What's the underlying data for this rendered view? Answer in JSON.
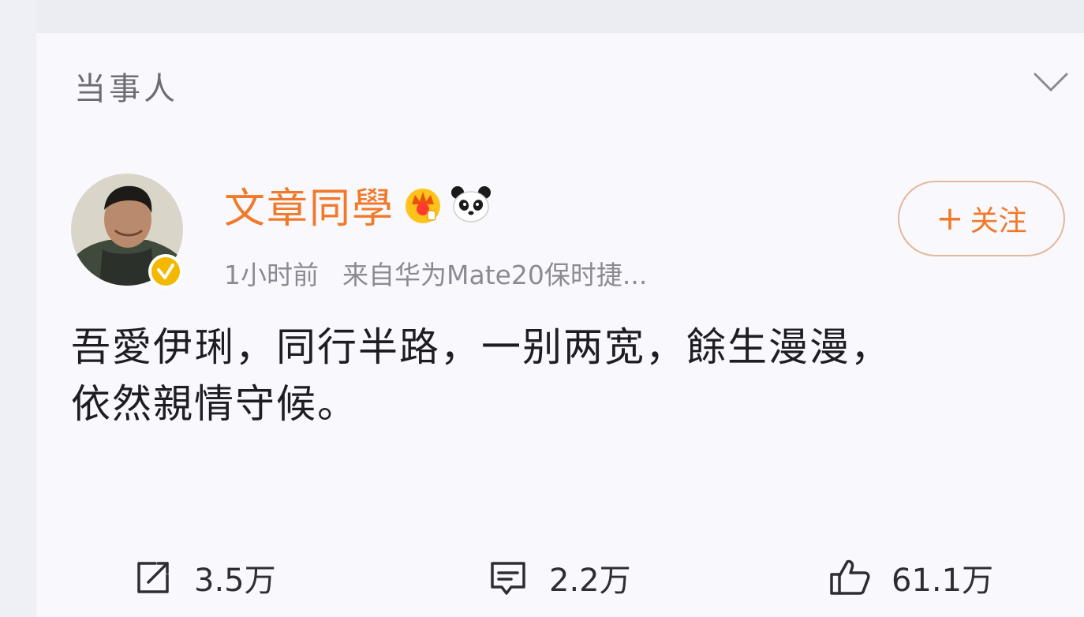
{
  "section": {
    "label": "当事人"
  },
  "user": {
    "name": "文章同學",
    "badges": [
      "crown-icon",
      "panda-icon"
    ],
    "verified": true
  },
  "post": {
    "time": "1小时前",
    "source": "来自华为Mate20保时捷...",
    "lines": [
      "吾愛伊琍，同行半路，一别两宽，餘生漫漫，",
      "依然親情守候。"
    ]
  },
  "follow_button": {
    "plus": "+",
    "label": "关注"
  },
  "actions": {
    "repost": {
      "icon": "repost-icon",
      "count": "3.5万"
    },
    "comment": {
      "icon": "comment-icon",
      "count": "2.2万"
    },
    "like": {
      "icon": "thumbs-up-icon",
      "count": "61.1万"
    }
  },
  "colors": {
    "accent": "#f07a2a",
    "follow_border": "#e2b89b",
    "muted_text": "#8b8b93",
    "body_text": "#1e1e22",
    "verified_badge": "#f5b800"
  }
}
